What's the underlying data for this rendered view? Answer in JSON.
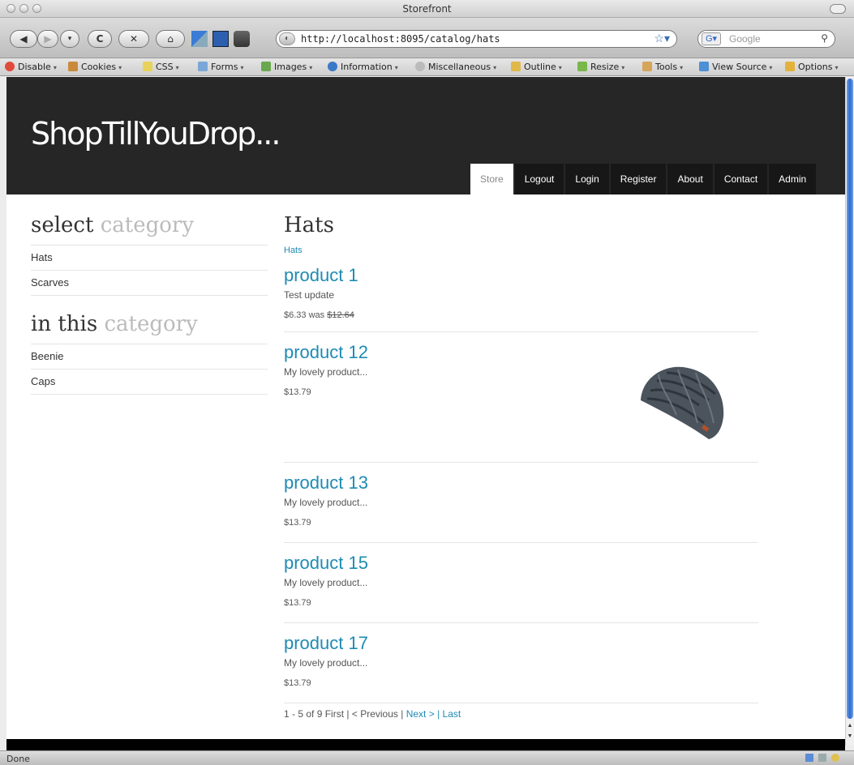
{
  "window": {
    "title": "Storefront"
  },
  "nav": {
    "url": "http://localhost:8095/catalog/hats",
    "search_placeholder": "Google"
  },
  "toolbar": {
    "items": [
      "Disable",
      "Cookies",
      "CSS",
      "Forms",
      "Images",
      "Information",
      "Miscellaneous",
      "Outline",
      "Resize",
      "Tools",
      "View Source",
      "Options"
    ]
  },
  "site": {
    "logo": "ShopTillYouDrop...",
    "menu": [
      "Store",
      "Logout",
      "Login",
      "Register",
      "About",
      "Contact",
      "Admin"
    ]
  },
  "sidebar": {
    "select_heading_dark": "select",
    "select_heading_light": "category",
    "categories": [
      "Hats",
      "Scarves"
    ],
    "inthis_heading_dark": "in this",
    "inthis_heading_light": "category",
    "subcategories": [
      "Beenie",
      "Caps"
    ]
  },
  "content": {
    "title": "Hats",
    "breadcrumb": "Hats",
    "products": [
      {
        "name": "product 1",
        "desc": "Test update",
        "price": "$6.33",
        "was_label": "was",
        "was_price": "$12.64"
      },
      {
        "name": "product 12",
        "desc": "My lovely product...",
        "price": "$13.79",
        "image": "beanie-hat-image"
      },
      {
        "name": "product 13",
        "desc": "My lovely product...",
        "price": "$13.79"
      },
      {
        "name": "product 15",
        "desc": "My lovely product...",
        "price": "$13.79"
      },
      {
        "name": "product 17",
        "desc": "My lovely product...",
        "price": "$13.79"
      }
    ],
    "pager": {
      "summary": "1 - 5 of 9",
      "first": "First",
      "sep1": "|",
      "prev": "< Previous",
      "sep2": "|",
      "next": "Next >",
      "sep3": "|",
      "last": "Last"
    }
  },
  "status": {
    "text": "Done"
  }
}
